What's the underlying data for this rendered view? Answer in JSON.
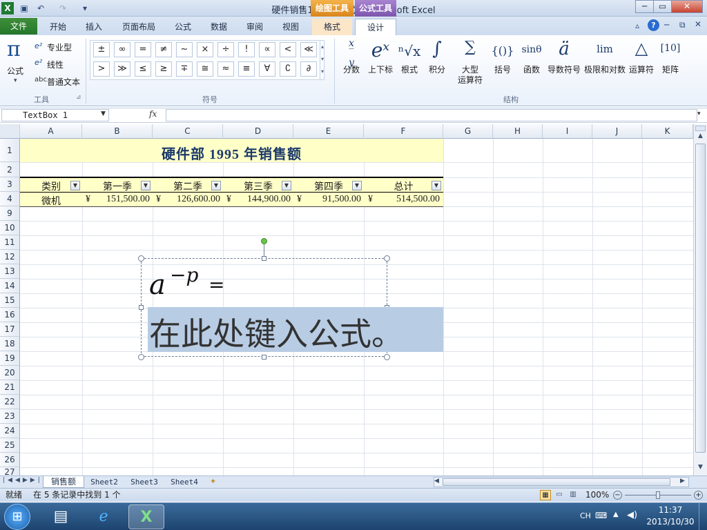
{
  "window": {
    "title": "硬件销售1  [兼容模式] - Microsoft Excel",
    "context_tab_drawing": "绘图工具",
    "context_tab_equation": "公式工具",
    "min": "─",
    "max": "▭",
    "close": "✕"
  },
  "ribbon_tabs": [
    {
      "label": "文件"
    },
    {
      "label": "开始"
    },
    {
      "label": "插入"
    },
    {
      "label": "页面布局"
    },
    {
      "label": "公式"
    },
    {
      "label": "数据"
    },
    {
      "label": "审阅"
    },
    {
      "label": "视图"
    },
    {
      "label": "格式"
    },
    {
      "label": "设计"
    }
  ],
  "tools_group": {
    "equation_label": "公式",
    "professional": "专业型",
    "linear": "线性",
    "normal_text": "普通文本",
    "group_label": "工具"
  },
  "symbols_group": {
    "row1": [
      "±",
      "∞",
      "=",
      "≠",
      "~",
      "×",
      "÷",
      "!",
      "∝",
      "<",
      "≪"
    ],
    "row2": [
      ">",
      "≫",
      "≤",
      "≥",
      "∓",
      "≅",
      "≈",
      "≡",
      "∀",
      "∁",
      "∂"
    ],
    "group_label": "符号"
  },
  "structures_group": {
    "items": [
      {
        "glyph": "x/y",
        "label": "分数"
      },
      {
        "glyph": "eˣ",
        "label": "上下标"
      },
      {
        "glyph": "ⁿ√x",
        "label": "根式"
      },
      {
        "glyph": "∫",
        "label": "积分"
      },
      {
        "glyph": "∑",
        "label": "大型\n运算符"
      },
      {
        "glyph": "{()}",
        "label": "括号"
      },
      {
        "glyph": "sinθ",
        "label": "函数"
      },
      {
        "glyph": "ä",
        "label": "导数符号"
      },
      {
        "glyph": "lim",
        "label": "极限和对数"
      },
      {
        "glyph": "△",
        "label": "运算符"
      },
      {
        "glyph": "[10]",
        "label": "矩阵"
      }
    ],
    "group_label": "结构"
  },
  "formula_bar": {
    "name_box": "TextBox 1",
    "fx": "fx",
    "content": ""
  },
  "columns": [
    "A",
    "B",
    "C",
    "D",
    "E",
    "F",
    "G",
    "H",
    "I",
    "J",
    "K"
  ],
  "rows": [
    "1",
    "2",
    "3",
    "4",
    "9",
    "10",
    "11",
    "12",
    "13",
    "14",
    "15",
    "16",
    "17",
    "18",
    "19",
    "20",
    "21",
    "22",
    "23",
    "24",
    "25",
    "26",
    "27"
  ],
  "sheet": {
    "title": "硬件部  1995  年销售额",
    "headers": [
      "类别",
      "第一季",
      "第二季",
      "第三季",
      "第四季",
      "总计"
    ],
    "data_row": {
      "category": "微机",
      "currency": "¥",
      "values": [
        "151,500.00",
        "126,600.00",
        "144,900.00",
        "91,500.00",
        "514,500.00"
      ]
    }
  },
  "textbox": {
    "equation_base": "a",
    "equation_exponent": "−p",
    "equation_equals": "=",
    "placeholder": "在此处键入公式。"
  },
  "sheet_tabs": [
    {
      "label": "销售额"
    },
    {
      "label": "Sheet2"
    },
    {
      "label": "Sheet3"
    },
    {
      "label": "Sheet4"
    }
  ],
  "status": {
    "ready": "就绪",
    "find_result": "在 5 条记录中找到 1 个",
    "zoom": "100%"
  },
  "taskbar": {
    "lang": "CH",
    "time": "11:37",
    "date": "2013/10/30"
  },
  "colors": {
    "title_band": "#ffffc8",
    "selection": "#b8cce4",
    "file_tab": "#2f8a34",
    "drawing_tab": "#e0962a",
    "equation_tab": "#8a63b8"
  }
}
